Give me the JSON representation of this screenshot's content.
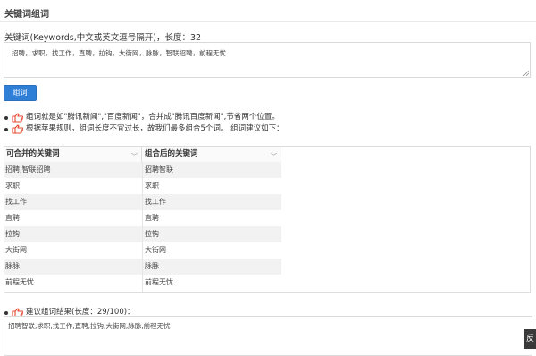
{
  "header": {
    "title": "关键词组词"
  },
  "keywords": {
    "label": "关键词(Keywords,中文或英文逗号隔开)，长度：32",
    "value": "招聘，求职，找工作，直聘，拉钩，大街网，脉脉，智联招聘，前程无忧"
  },
  "combine_button": "组词",
  "tips": [
    "组词就是如\"腾讯新闻\",\"百度新闻\"，合并成\"腾讯百度新闻\",节省两个位置。",
    "根据苹果规则，组词长度不宜过长，故我们最多组合5个词。 组词建议如下："
  ],
  "table": {
    "headers": [
      "可合并的关键词",
      "组合后的关键词"
    ],
    "rows": [
      [
        "招聘,智联招聘",
        "招聘智联"
      ],
      [
        "求职",
        "求职"
      ],
      [
        "找工作",
        "找工作"
      ],
      [
        "直聘",
        "直聘"
      ],
      [
        "拉钩",
        "拉钩"
      ],
      [
        "大街网",
        "大街网"
      ],
      [
        "脉脉",
        "脉脉"
      ],
      [
        "前程无忧",
        "前程无忧"
      ]
    ]
  },
  "result": {
    "label": "建议组词结果(长度：29/100)：",
    "value": "招聘智联,求职,找工作,直聘,拉钩,大街网,脉脉,前程无忧"
  },
  "feedback_tab": "反",
  "colors": {
    "button": "#2f7fd6",
    "hand_icon": "#e8432e"
  },
  "icons": {
    "tip": "pointing-hand-icon",
    "sort": "chevron-down-icon"
  }
}
